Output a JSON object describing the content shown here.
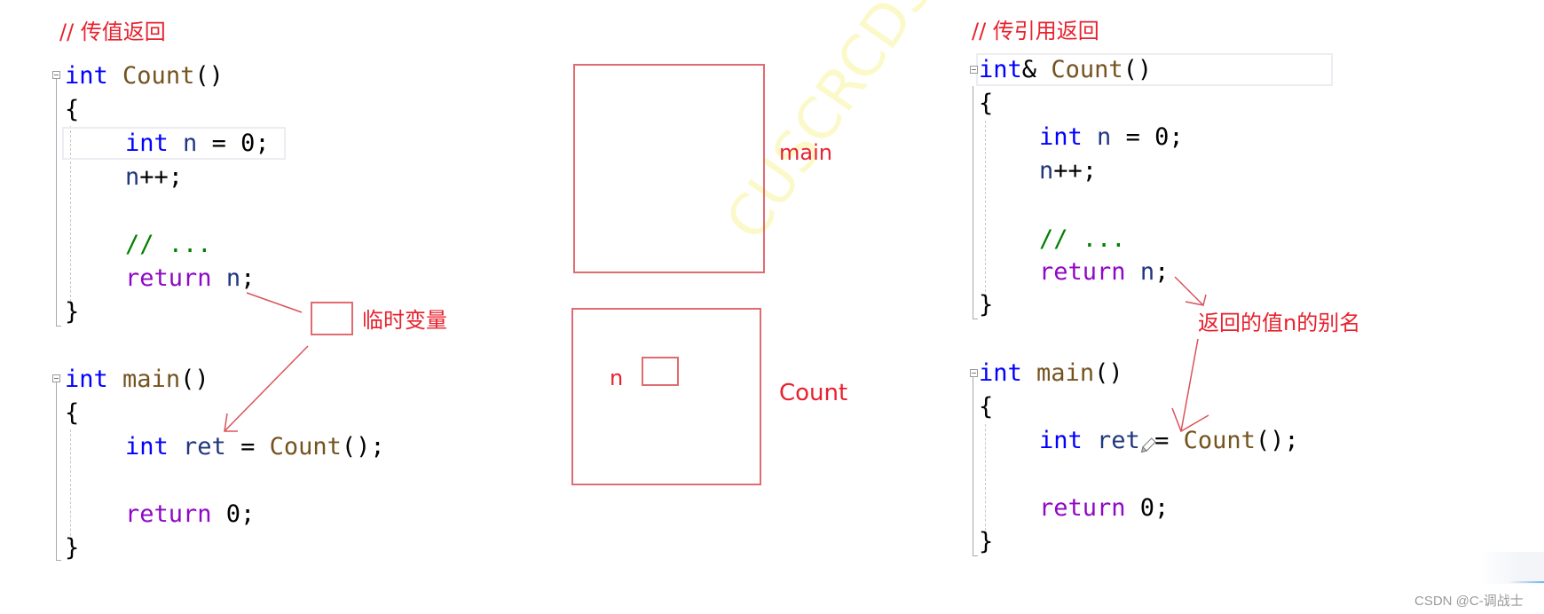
{
  "left_panel": {
    "title": "// 传值返回",
    "count_func": {
      "signature": {
        "kw": "int",
        "name": "Count",
        "parens": "()"
      },
      "open_brace": "{",
      "decl": {
        "kw": "int",
        "var": "n",
        "rest": " = 0;"
      },
      "incr": {
        "var": "n",
        "rest": "++;"
      },
      "comment": "// ...",
      "ret": {
        "kw": "return",
        "var": "n",
        "rest": ";"
      },
      "close_brace": "}"
    },
    "main_func": {
      "signature": {
        "kw": "int",
        "name": "main",
        "parens": "()"
      },
      "open_brace": "{",
      "assign": {
        "kw": "int",
        "var": "ret",
        "eq": " = ",
        "call": "Count",
        "rest": "();"
      },
      "ret": {
        "kw": "return",
        "rest": " 0;"
      },
      "close_brace": "}"
    },
    "annotation": {
      "label": "临时变量"
    }
  },
  "diagram": {
    "main_frame_label": "main",
    "count_frame_label": "Count",
    "var_label": "n",
    "watermark": "CUSCRCDS"
  },
  "right_panel": {
    "title": "// 传引用返回",
    "count_func": {
      "signature": {
        "kw": "int",
        "amp": "&",
        "name": "Count",
        "parens": "()"
      },
      "open_brace": "{",
      "decl": {
        "kw": "int",
        "var": "n",
        "rest": " = 0;"
      },
      "incr": {
        "var": "n",
        "rest": "++;"
      },
      "comment": "// ...",
      "ret": {
        "kw": "return",
        "var": "n",
        "rest": ";"
      },
      "close_brace": "}"
    },
    "main_func": {
      "signature": {
        "kw": "int",
        "name": "main",
        "parens": "()"
      },
      "open_brace": "{",
      "assign": {
        "kw": "int",
        "var": "ret",
        "eq": " = ",
        "call": "Count",
        "rest": "();"
      },
      "ret": {
        "kw": "return",
        "rest": " 0;"
      },
      "close_brace": "}"
    },
    "annotation": {
      "label": "返回的值n的别名"
    },
    "cursor_icon": "pencil-cursor-icon"
  },
  "footer": {
    "credit": "CSDN @C-调战士"
  },
  "colors": {
    "annotation_red": "#e8222e",
    "keyword_blue": "#0000ff",
    "control_purple": "#8f08c4",
    "function_brown": "#74531f",
    "variable_navy": "#1f377f",
    "comment_green": "#008000"
  }
}
